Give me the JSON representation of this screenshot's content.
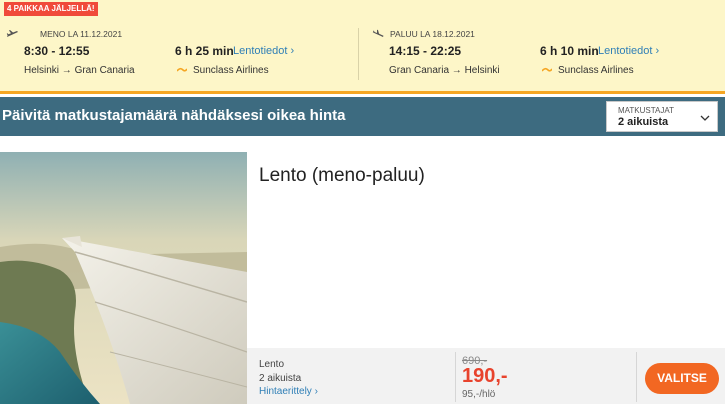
{
  "flight_summary": {
    "seats_badge": "4 PAIKKAA JÄLJELLÄ!",
    "outbound": {
      "date_label": "MENO LA 11.12.2021",
      "times": "8:30 - 12:55",
      "duration": "6 h 25 min",
      "info_link": "Lentotiedot",
      "route": "Helsinki → Gran Canaria",
      "airline": "Sunclass Airlines",
      "icon": "plane-takeoff-icon"
    },
    "return": {
      "date_label": "PALUU LA 18.12.2021",
      "times": "14:15 - 22:25",
      "duration": "6 h 10 min",
      "info_link": "Lentotiedot",
      "route": "Gran Canaria → Helsinki",
      "airline": "Sunclass Airlines",
      "icon": "plane-landing-icon"
    }
  },
  "update_bar": {
    "title": "Päivitä matkustajamäärä nähdäksesi oikea hinta",
    "travelers_label": "MATKUSTAJAT",
    "travelers_value": "2 aikuista"
  },
  "product": {
    "title": "Lento (meno-paluu)",
    "fare_type": "Lento",
    "travelers": "2 aikuista",
    "breakdown_link": "Hintaerittely",
    "old_price": "690,-",
    "price": "190,-",
    "per_person": "95,-/hlö",
    "select_button": "VALITSE"
  },
  "colors": {
    "panel_bg": "#fdf6c8",
    "badge": "#f04a3a",
    "update_bar": "#3d6b80",
    "price": "#e8432d",
    "button": "#f26722",
    "link": "#2f7fb6"
  }
}
